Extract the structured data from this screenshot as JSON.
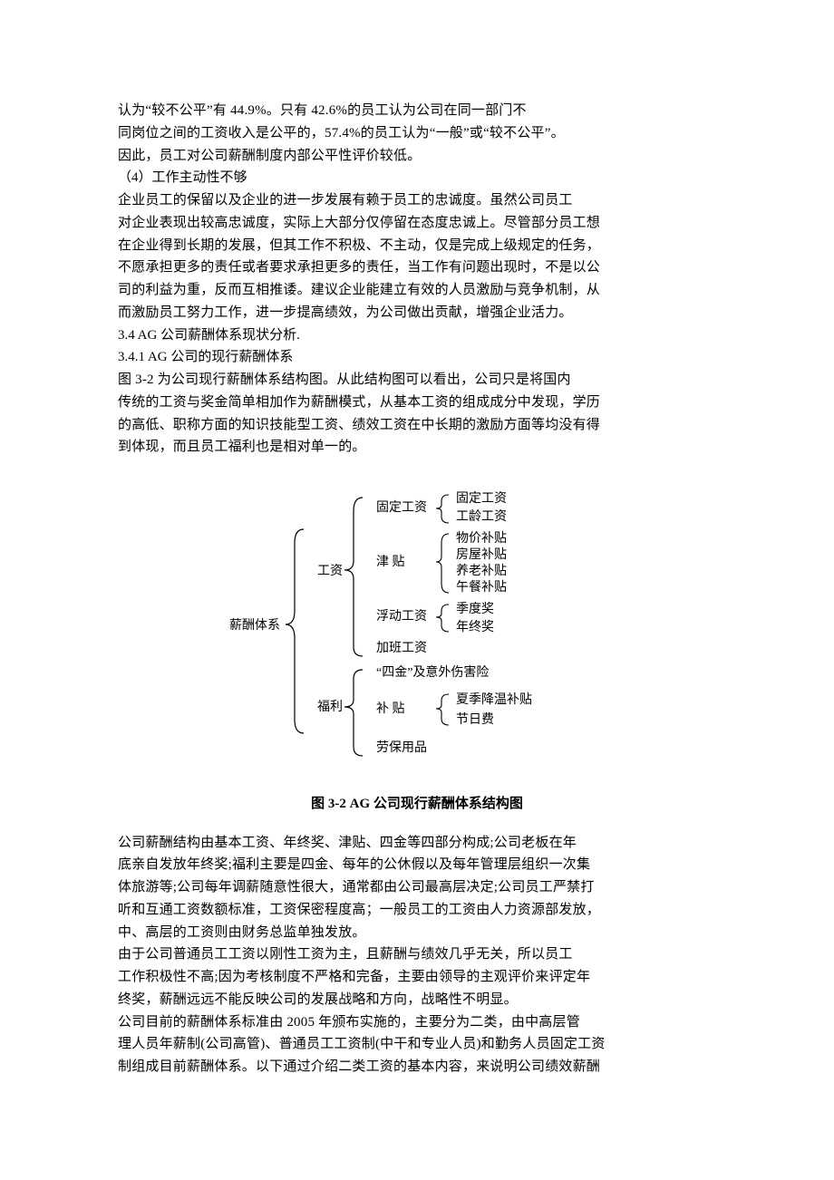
{
  "paragraph1": {
    "l1": "认为“较不公平”有 44.9%。只有 42.6%的员工认为公司在同一部门不",
    "l2": "同岗位之间的工资收入是公平的，57.4%的员工认为“一般”或“较不公平”。",
    "l3": "因此，员工对公司薪酬制度内部公平性评价较低。"
  },
  "heading4": "（4）工作主动性不够",
  "paragraph2": {
    "l1": "企业员工的保留以及企业的进一步发展有赖于员工的忠诚度。虽然公司员工",
    "l2": "对企业表现出较高忠诚度，实际上大部分仅停留在态度忠诚上。尽管部分员工想",
    "l3": "在企业得到长期的发展，但其工作不积极、不主动，仅是完成上级规定的任务，",
    "l4": "不愿承担更多的责任或者要求承担更多的责任，当工作有问题出现时，不是以公",
    "l5": "司的利益为重，反而互相推诿。建议企业能建立有效的人员激励与竞争机制，从",
    "l6": "而激励员工努力工作，进一步提高绩效，为公司做出贡献，增强企业活力。"
  },
  "heading34": "3.4 AG 公司薪酬体系现状分析.",
  "heading341": "3.4.1 AG 公司的现行薪酬体系",
  "paragraph3": {
    "l1": "图 3-2 为公司现行薪酬体系结构图。从此结构图可以看出，公司只是将国内",
    "l2": "传统的工资与奖金简单相加作为薪酬模式，从基本工资的组成成分中发现，学历",
    "l3": "的高低、职称方面的知识技能型工资、绩效工资在中长期的激励方面等均没有得",
    "l4": "到体现，而且员工福利也是相对单一的。"
  },
  "caption": "图 3-2   AG 公司现行薪酬体系结构图",
  "paragraph4": {
    "l1": "公司薪酬结构由基本工资、年终奖、津贴、四金等四部分构成;公司老板在年",
    "l2": "底亲自发放年终奖;福利主要是四金、每年的公休假以及每年管理层组织一次集",
    "l3": "体旅游等;公司每年调薪随意性很大，通常都由公司最高层决定;公司员工严禁打",
    "l4": "听和互通工资数额标准，工资保密程度高；一般员工的工资由人力资源部发放，",
    "l5": "中、高层的工资则由财务总监单独发放。"
  },
  "paragraph5": {
    "l1": "由于公司普通员工工资以刚性工资为主，且薪酬与绩效几乎无关，所以员工",
    "l2": "工作积极性不高;因为考核制度不严格和完备，主要由领导的主观评价来评定年",
    "l3": "终奖，薪酬远远不能反映公司的发展战略和方向，战略性不明显。"
  },
  "paragraph6": {
    "l1": "公司目前的薪酬体系标准由 2005 年颁布实施的，主要分为二类，由中高层管",
    "l2": "理人员年薪制(公司高管)、普通员工工资制(中干和专业人员)和勤务人员固定工资",
    "l3": "制组成目前薪酬体系。以下通过介绍二类工资的基本内容，来说明公司绩效薪酬"
  },
  "diagram": {
    "root": "薪酬体系",
    "branches": [
      {
        "label": "工资",
        "children": [
          {
            "label": "固定工资",
            "leaves": [
              "固定工资",
              "工龄工资"
            ]
          },
          {
            "label": "津    贴",
            "leaves": [
              "物价补贴",
              "房屋补贴",
              "养老补贴",
              "午餐补贴"
            ]
          },
          {
            "label": "浮动工资",
            "leaves": [
              "季度奖",
              "年终奖"
            ]
          },
          {
            "label": "加班工资",
            "leaves": []
          }
        ]
      },
      {
        "label": "福利",
        "children": [
          {
            "label": "“四金”及意外伤害险",
            "leaves": []
          },
          {
            "label": "补    贴",
            "leaves": [
              "夏季降温补贴",
              "节日费"
            ]
          },
          {
            "label": "劳保用品",
            "leaves": []
          }
        ]
      }
    ]
  }
}
